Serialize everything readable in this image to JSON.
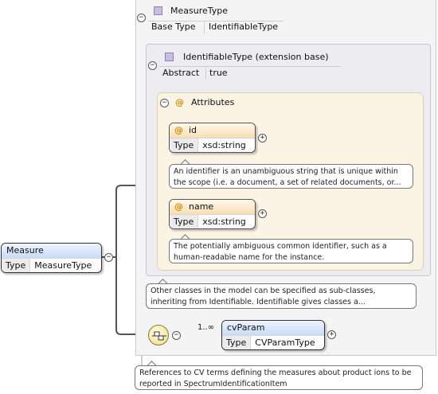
{
  "measure_type": {
    "title": "MeasureType",
    "base_type_label": "Base Type",
    "base_type_value": "IdentifiableType"
  },
  "identifiable_type": {
    "title": "IdentifiableType (extension base)",
    "abstract_label": "Abstract",
    "abstract_value": "true"
  },
  "attributes": {
    "title": "Attributes",
    "id": {
      "name": "id",
      "type_label": "Type",
      "type_value": "xsd:string",
      "doc": "An identifier is an unambiguous string that is unique within the scope (i.e. a document, a set of related documents, or..."
    },
    "name": {
      "name": "name",
      "type_label": "Type",
      "type_value": "xsd:string",
      "doc": "The potentially ambiguous common identifier, such as a human-readable name for the instance."
    }
  },
  "identifiable_doc": "Other classes in the model can be specified as sub-classes, inheriting from Identifiable. Identifiable gives classes a...",
  "measure": {
    "name": "Measure",
    "type_label": "Type",
    "type_value": "MeasureType"
  },
  "cvparam": {
    "name": "cvParam",
    "type_label": "Type",
    "type_value": "CVParamType",
    "cardinality": "1..∞",
    "doc": "References to CV terms defining the measures about product ions to be reported in SpectrumIdentificationItem"
  },
  "symbols": {
    "collapse": "−",
    "expand": "+",
    "attribute_marker": "@"
  },
  "colors": {
    "element_header": "#c9dbf6",
    "attribute_header": "#f7dfb3",
    "complex_type_icon": "#c9bde0",
    "attributes_panel": "#fbf3e4"
  }
}
